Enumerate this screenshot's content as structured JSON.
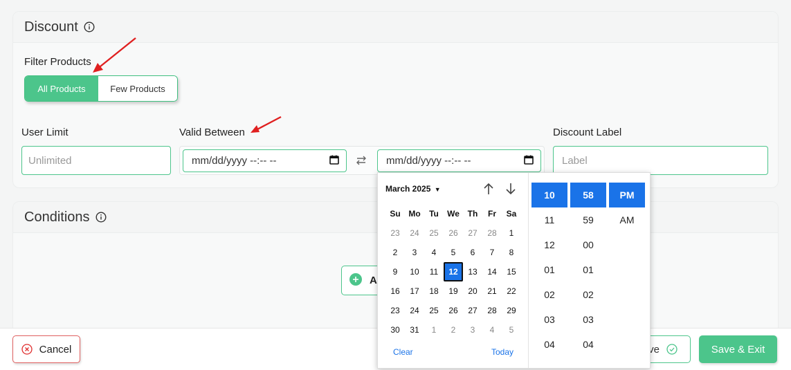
{
  "discount": {
    "title": "Discount",
    "filter_label": "Filter Products",
    "filter_options": [
      "All Products",
      "Few Products"
    ],
    "user_limit_label": "User Limit",
    "user_limit_placeholder": "Unlimited",
    "valid_between_label": "Valid Between",
    "date_placeholder": "mm/dd/yyyy --:-- --",
    "discount_label_label": "Discount Label",
    "discount_label_placeholder": "Label"
  },
  "conditions": {
    "title": "Conditions",
    "add_button_partial": "A"
  },
  "picker": {
    "month_label": "March 2025",
    "weekdays": [
      "Su",
      "Mo",
      "Tu",
      "We",
      "Th",
      "Fr",
      "Sa"
    ],
    "days": [
      [
        "23",
        "24",
        "25",
        "26",
        "27",
        "28",
        "1"
      ],
      [
        "2",
        "3",
        "4",
        "5",
        "6",
        "7",
        "8"
      ],
      [
        "9",
        "10",
        "11",
        "12",
        "13",
        "14",
        "15"
      ],
      [
        "16",
        "17",
        "18",
        "19",
        "20",
        "21",
        "22"
      ],
      [
        "23",
        "24",
        "25",
        "26",
        "27",
        "28",
        "29"
      ],
      [
        "30",
        "31",
        "1",
        "2",
        "3",
        "4",
        "5"
      ]
    ],
    "selected_day": "12",
    "clear_label": "Clear",
    "today_label": "Today",
    "hours": [
      "10",
      "11",
      "12",
      "01",
      "02",
      "03",
      "04"
    ],
    "minutes": [
      "58",
      "59",
      "00",
      "01",
      "02",
      "03",
      "04"
    ],
    "meridiem": [
      "PM",
      "AM"
    ]
  },
  "footer": {
    "cancel_label": "Cancel",
    "save_partial_label": "ve",
    "save_exit_label": "Save & Exit"
  },
  "colors": {
    "green": "#4cc58b",
    "blue": "#1a73e8",
    "red": "#e03030"
  }
}
